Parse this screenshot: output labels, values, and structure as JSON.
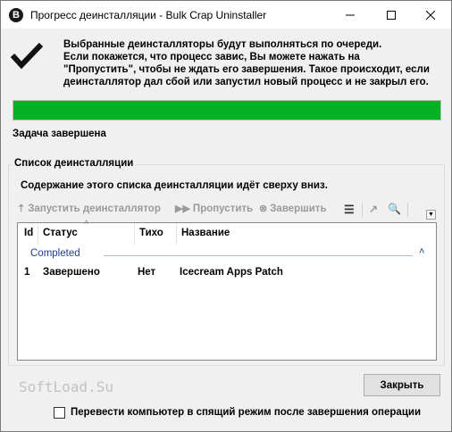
{
  "window": {
    "app_icon_letter": "B",
    "title": "Прогресс деинсталляции - Bulk Crap Uninstaller"
  },
  "message": "Выбранные деинсталляторы будут выполняться по очереди.\nЕсли покажется, что процесс завис, Вы можете нажать на\n\"Пропустить\", чтобы не ждать его завершения. Такое происходит, если\nдеинсталлятор дал сбой или запустил новый процесс и не закрыл его.",
  "progress": {
    "value": 1.0,
    "color": "#06b025"
  },
  "status_text": "Задача завершена",
  "uninstall_list": {
    "group_title": "Список деинсталляции",
    "description": "Содержание этого списка деинсталляции идёт сверху вниз.",
    "toolbar": {
      "run_label": "Запустить деинсталлятор",
      "skip_label": "Пропустить",
      "terminate_label": "Завершить"
    },
    "columns": [
      "Id",
      "Статус",
      "Тихо",
      "Название"
    ],
    "groups": [
      {
        "title": "Completed",
        "rows": [
          {
            "id": "1",
            "status": "Завершено",
            "quiet": "Нет",
            "name": "Icecream Apps Patch"
          }
        ]
      }
    ]
  },
  "watermark": "SoftLoad.Su",
  "close_button_label": "Закрыть",
  "sleep_option": {
    "label": "Перевести компьютер в спящий режим после завершения операции",
    "checked": false
  }
}
